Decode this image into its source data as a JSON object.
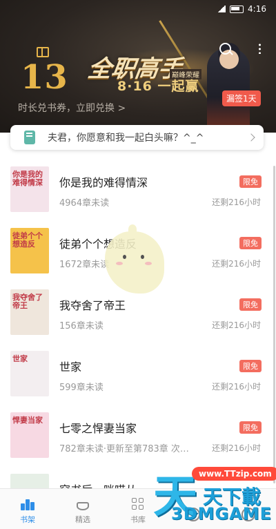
{
  "status_bar": {
    "time": "4:16"
  },
  "banner": {
    "number": "13",
    "event_title": "全职高手",
    "event_sub": "巅峰荣耀",
    "event_date": "8·16 一起赢",
    "promo": "时长兑书券，立即兑换 >",
    "sign_badge": "漏签1天"
  },
  "notice": {
    "text": "夫君，你愿意和我一起白头嘛？^_^"
  },
  "books": [
    {
      "cover_title": "你是我的难得情深",
      "title": "你是我的难得情深",
      "unread": "4964章未读",
      "tag": "限免",
      "remain": "还剩216小时",
      "cover_color": "#f4e3ea"
    },
    {
      "cover_title": "徒弟个个想造反",
      "title": "徒弟个个想造反",
      "unread": "1672章未读",
      "tag": "限免",
      "remain": "还剩216小时",
      "cover_color": "#f5c24a"
    },
    {
      "cover_title": "我夺舍了帝王",
      "title": "我夺舍了帝王",
      "unread": "156章未读",
      "tag": "限免",
      "remain": "还剩216小时",
      "cover_color": "#efe6dc"
    },
    {
      "cover_title": "世家",
      "title": "世家",
      "unread": "599章未读",
      "tag": "限免",
      "remain": "还剩216小时",
      "cover_color": "#f3eef0"
    },
    {
      "cover_title": "悍妻当家",
      "title": "七零之悍妻当家",
      "unread": "782章未读·更新至第783章 次…",
      "tag": "限免",
      "remain": "还剩216小时",
      "cover_color": "#f7d9e3"
    },
    {
      "cover_title": "",
      "title": "穿书后，咪喵从…",
      "unread": "",
      "tag": "",
      "remain": "",
      "cover_color": "#e6efe6"
    }
  ],
  "nav": {
    "shelf": "书架",
    "featured": "精选",
    "library": "书库",
    "me": ""
  },
  "watermark": {
    "url": "www.TTzip.com",
    "big": "天",
    "small": "天下載",
    "game": "3DMGAME"
  },
  "colors": {
    "accent_blue": "#2e8ee8",
    "tag_red": "#f36d5f",
    "banner_gold": "#e7b54a"
  }
}
